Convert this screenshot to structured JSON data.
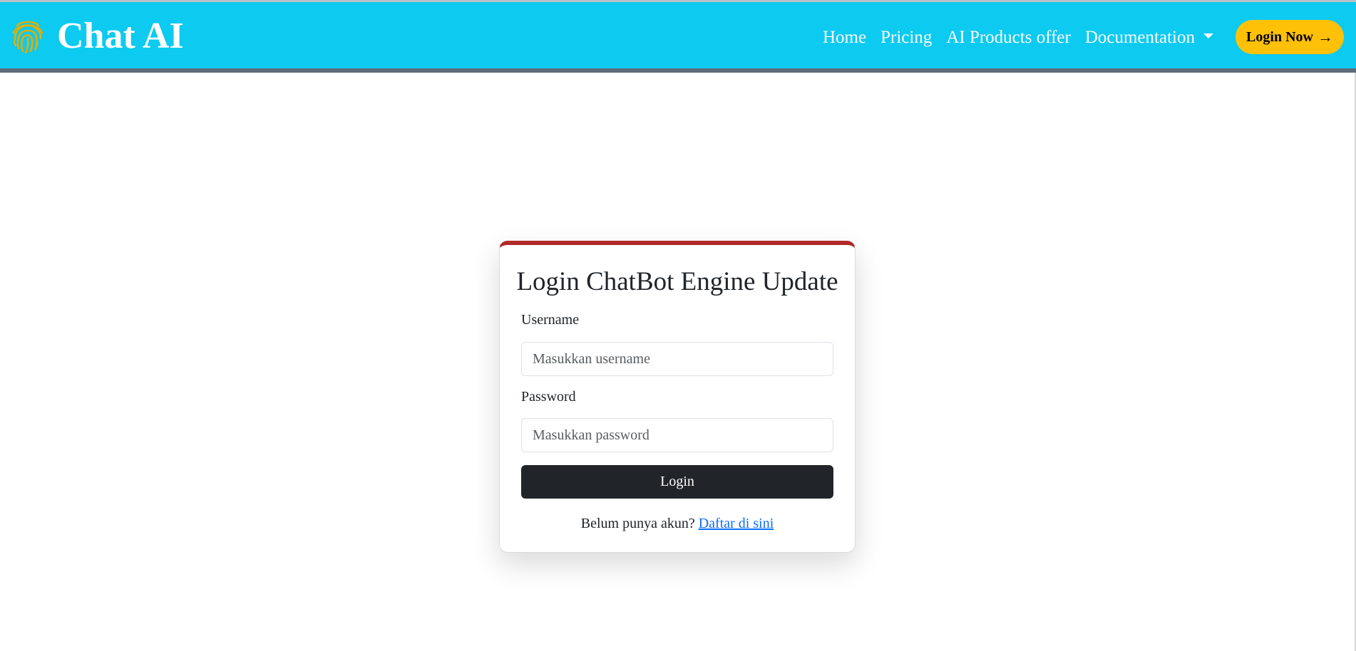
{
  "colors": {
    "navbar_bg": "#0dcaf0",
    "navbar_text": "#ffffff",
    "login_now_bg": "#ffc107",
    "card_top_border": "#b02a2a",
    "login_button_bg": "#212529",
    "link": "#0d6efd"
  },
  "brand": {
    "icon": "fingerprint-icon",
    "title": "Chat AI"
  },
  "nav": {
    "items": [
      {
        "label": "Home"
      },
      {
        "label": "Pricing"
      },
      {
        "label": "AI Products offer"
      }
    ],
    "dropdown": {
      "label": "Documentation",
      "icon": "caret-down-icon"
    },
    "cta": {
      "label": "Login Now",
      "icon": "arrow-right-icon",
      "arrow": "→"
    }
  },
  "login_card": {
    "title": "Login ChatBot Engine Update",
    "username": {
      "label": "Username",
      "placeholder": "Masukkan username",
      "value": ""
    },
    "password": {
      "label": "Password",
      "placeholder": "Masukkan password",
      "value": ""
    },
    "submit_label": "Login",
    "signup_prompt": "Belum punya akun?",
    "signup_link": "Daftar di sini"
  }
}
